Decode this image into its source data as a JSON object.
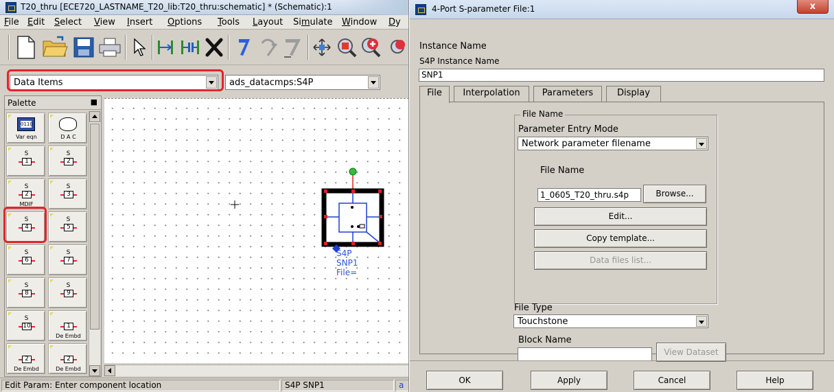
{
  "schematic": {
    "title": "T20_thru [ECE720_LASTNAME_T20_lib:T20_thru:schematic] * (Schematic):1",
    "menu": [
      "File",
      "Edit",
      "Select",
      "View",
      "Insert",
      "Options",
      "Tools",
      "Layout",
      "Simulate",
      "Window",
      "Dy"
    ],
    "menu_underline": [
      "F",
      "E",
      "S",
      "V",
      "I",
      "O",
      "T",
      "L",
      "m",
      "W",
      "D"
    ],
    "toolbar_icons": [
      "new-document-icon",
      "open-folder-icon",
      "save-icon",
      "print-icon",
      "select-arrow-icon",
      "insert-wire-icon",
      "insert-pin-icon",
      "delete-x-icon",
      "undo-icon",
      "redo-icon",
      "rotate-icon",
      "move-icon",
      "zoom-component-icon",
      "simulate-icon",
      "tuning-icon"
    ],
    "palette_combo": "Data Items",
    "component_combo": "ads_datacmps:S4P",
    "palette": {
      "title": "Palette",
      "items": [
        {
          "s": "",
          "num": "",
          "label": "Var eqn",
          "kind": "vareqn"
        },
        {
          "s": "",
          "num": "",
          "label": "D A C",
          "kind": "dac"
        },
        {
          "s": "S",
          "num": "1",
          "label": "",
          "kind": "sp"
        },
        {
          "s": "S",
          "num": "2",
          "label": "",
          "kind": "sp"
        },
        {
          "s": "S",
          "num": "2",
          "label": "MDIF",
          "kind": "sp"
        },
        {
          "s": "S",
          "num": "3",
          "label": "",
          "kind": "sp"
        },
        {
          "s": "S",
          "num": "4",
          "label": "",
          "kind": "sp"
        },
        {
          "s": "S",
          "num": "5",
          "label": "",
          "kind": "sp"
        },
        {
          "s": "S",
          "num": "6",
          "label": "",
          "kind": "sp"
        },
        {
          "s": "S",
          "num": "7",
          "label": "",
          "kind": "sp"
        },
        {
          "s": "S",
          "num": "8",
          "label": "",
          "kind": "sp"
        },
        {
          "s": "S",
          "num": "9",
          "label": "",
          "kind": "sp"
        },
        {
          "s": "S",
          "num": "10",
          "label": "",
          "kind": "sp"
        },
        {
          "s": "",
          "num": "1",
          "label": "De Embd",
          "kind": "sp"
        },
        {
          "s": "",
          "num": "2",
          "label": "De Embd",
          "kind": "sp"
        },
        {
          "s": "",
          "num": "2",
          "label": "De Embd",
          "kind": "sp"
        }
      ]
    },
    "component": {
      "type": "S4P",
      "instance": "SNP1",
      "param": "File="
    },
    "status": [
      "Edit Param: Enter component location",
      "S4P SNP1",
      "a"
    ],
    "highlight_color": "#e0262b"
  },
  "dialog": {
    "title": "4-Port S-parameter File:1",
    "close_glyph": "x",
    "instance_name_heading": "Instance Name",
    "instance_name_label": "S4P Instance Name",
    "instance_name_value": "SNP1",
    "tabs": [
      "File",
      "Interpolation",
      "Parameters",
      "Display"
    ],
    "active_tab": "File",
    "file_group_title": "File Name",
    "parameter_entry_mode_label": "Parameter Entry Mode",
    "parameter_entry_mode_value": "Network parameter filename",
    "file_name_label": "File Name",
    "file_name_value": "1_0605_T20_thru.s4p",
    "browse_label": "Browse...",
    "edit_label": "Edit...",
    "copy_template_label": "Copy template...",
    "data_files_list_label": "Data files list...",
    "file_type_label": "File Type",
    "file_type_value": "Touchstone",
    "block_name_label": "Block Name",
    "block_name_value": "",
    "view_dataset_label": "View Dataset",
    "buttons": {
      "ok": "OK",
      "apply": "Apply",
      "cancel": "Cancel",
      "help": "Help"
    }
  }
}
